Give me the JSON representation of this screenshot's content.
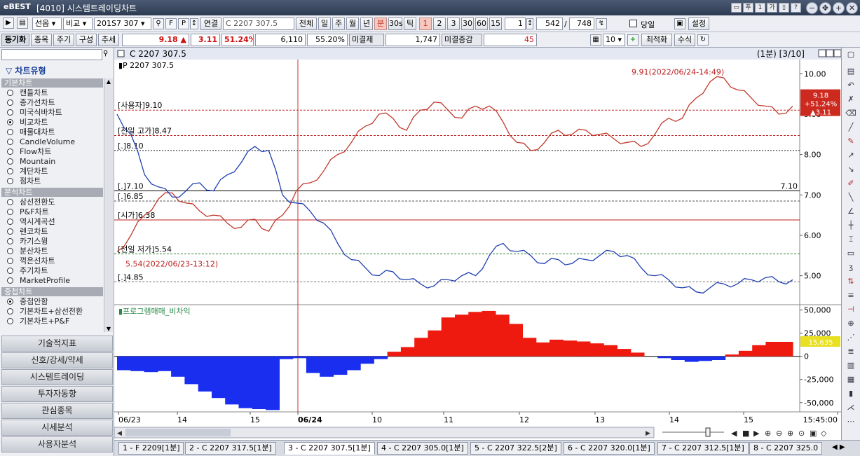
{
  "titlebar": {
    "logo": "eBEST",
    "code": "[4010]",
    "title": "시스템트레이딩차트"
  },
  "toolbar": {
    "product_type": "선옵",
    "compare": "비교",
    "contract": "201S7 307",
    "link": "연결",
    "contract_name": "C 2207 307.5",
    "all": "전체",
    "day": "일",
    "week": "주",
    "month": "월",
    "year": "년",
    "minute": "분",
    "sec30": "30s",
    "tick": "틱",
    "intervals": [
      "1",
      "2",
      "3",
      "30",
      "60",
      "15"
    ],
    "interval_value": "1",
    "view_count": "542",
    "total_count": "748",
    "same_day": "당일",
    "settings": "설정"
  },
  "toolbar2": {
    "sync": "동기화",
    "item": "종목",
    "period": "주기",
    "compose": "구성",
    "trend": "추세",
    "price": "9.18",
    "change": "3.11",
    "change_pct": "51.24%",
    "volume": "6,110",
    "ratio": "55.20%",
    "unsettled_label": "미결제",
    "unsettled_value": "1,747",
    "unsettled_chg_label": "미결증감",
    "unsettled_chg_value": "45",
    "chart_count": "10",
    "optimize": "최적화",
    "formula": "수식"
  },
  "sidebar": {
    "header": "차트유형",
    "basic_section": "기본차트",
    "basic_items": [
      {
        "label": "캔들차트",
        "selected": false
      },
      {
        "label": "종가선차트",
        "selected": false
      },
      {
        "label": "미국식바차트",
        "selected": false
      },
      {
        "label": "비교차트",
        "selected": true
      },
      {
        "label": "매물대차트",
        "selected": false
      },
      {
        "label": "CandleVolume",
        "selected": false
      },
      {
        "label": "Flow차트",
        "selected": false
      },
      {
        "label": "Mountain",
        "selected": false
      },
      {
        "label": "계단차트",
        "selected": false
      },
      {
        "label": "점차트",
        "selected": false
      }
    ],
    "analysis_section": "분석차트",
    "analysis_items": [
      {
        "label": "삼선전환도",
        "selected": false
      },
      {
        "label": "P&F차트",
        "selected": false
      },
      {
        "label": "역시계곡선",
        "selected": false
      },
      {
        "label": "렌코차트",
        "selected": false
      },
      {
        "label": "카기스윙",
        "selected": false
      },
      {
        "label": "분산차트",
        "selected": false
      },
      {
        "label": "꺽은선차트",
        "selected": false
      },
      {
        "label": "주기차트",
        "selected": false
      },
      {
        "label": "MarketProfile",
        "selected": false
      }
    ],
    "overlay_section": "중첩차트",
    "overlay_items": [
      {
        "label": "중첩안함",
        "selected": true
      },
      {
        "label": "기본차트+삼선전환",
        "selected": false
      },
      {
        "label": "기본차트+P&F",
        "selected": false
      }
    ],
    "categories": [
      "기술적지표",
      "신호/강세/약세",
      "시스템트레이딩",
      "투자자동향",
      "관심종목",
      "시세분석",
      "사용자분석"
    ]
  },
  "chart": {
    "header_name": "C 2207 307.5",
    "header_info": "(1분) [3/10]",
    "price_legend": "P 2207 307.5",
    "annotations": {
      "high": "9.91(2022/06/24-14:49)",
      "low": "5.54(2022/06/23-13:12)",
      "user": "[사용자]9.10",
      "prev_high": "[전일 고가]8.47",
      "l810": "[.]8.10",
      "l710": "[.]7.10",
      "l685": "[.]6.85",
      "open": "[시가]6.38",
      "prev_low": "[전일 저가]5.54",
      "l485": "[.]4.85",
      "right_710": "7.10"
    },
    "price_badge": [
      "9.18",
      "+51.24%",
      "▲3.11"
    ],
    "volume_legend": "프로그램매매_비차익",
    "volume_badge": "15,635",
    "x_labels": [
      "06/23",
      "14",
      "15",
      "06/24",
      "10",
      "11",
      "12",
      "13",
      "14",
      "15",
      "15:45:00"
    ]
  },
  "chart_data": [
    {
      "type": "line",
      "title": "C 2207 307.5",
      "ylim": [
        4.3,
        10.3
      ],
      "yticks": [
        "10.00",
        "9.00",
        "8.00",
        "7.00",
        "6.00",
        "5.00"
      ],
      "series": [
        {
          "name": "C 2207 307.5",
          "color": "#c0392b",
          "values": [
            5.6,
            6.0,
            6.5,
            6.9,
            7.05,
            6.8,
            6.6,
            6.5,
            6.3,
            6.2,
            6.4,
            6.1,
            6.5,
            7.1,
            7.3,
            7.6,
            8.0,
            8.3,
            8.7,
            9.0,
            8.9,
            8.6,
            9.1,
            9.3,
            9.1,
            8.9,
            9.2,
            9.2,
            8.8,
            8.3,
            8.1,
            8.3,
            8.6,
            8.5,
            8.6,
            8.5,
            8.4,
            8.3,
            8.2,
            8.5,
            8.9,
            8.9,
            9.4,
            9.8,
            9.9,
            9.6,
            9.4,
            9.2,
            9.0,
            9.2
          ]
        },
        {
          "name": "P 2207 307.5",
          "color": "#1f3fb0",
          "values": [
            9.0,
            8.5,
            7.5,
            7.2,
            6.95,
            7.1,
            7.3,
            7.1,
            7.5,
            7.8,
            8.2,
            8.1,
            7.0,
            6.8,
            6.6,
            6.3,
            5.8,
            5.4,
            5.2,
            5.0,
            5.1,
            4.9,
            4.8,
            4.75,
            4.9,
            5.0,
            5.0,
            5.5,
            5.8,
            5.6,
            5.5,
            5.3,
            5.4,
            5.3,
            5.4,
            5.5,
            5.6,
            5.5,
            5.2,
            5.0,
            4.9,
            4.7,
            4.6,
            4.7,
            4.8,
            4.8,
            4.9,
            4.95,
            4.85,
            4.9
          ]
        }
      ]
    },
    {
      "type": "area",
      "title": "프로그램매매_비차익",
      "ylim": [
        -60000,
        55000
      ],
      "yticks": [
        "50,000",
        "25,000",
        "0",
        "-25,000",
        "-50,000"
      ],
      "series": [
        {
          "name": "프로그램매매_비차익",
          "values": [
            -15000,
            -16000,
            -17000,
            -16000,
            -22000,
            -30000,
            -38000,
            -45000,
            -52000,
            -56000,
            -57000,
            -58000,
            -3000,
            -2000,
            -18000,
            -22000,
            -20000,
            -15000,
            -8000,
            -3000,
            5000,
            10000,
            20000,
            28000,
            42000,
            45000,
            48000,
            49000,
            45000,
            35000,
            20000,
            15000,
            18000,
            17000,
            16000,
            14000,
            12000,
            8000,
            4000,
            0,
            -2000,
            -4000,
            -6000,
            -5000,
            -4000,
            2000,
            6000,
            12000,
            15635,
            15635
          ]
        }
      ]
    }
  ]
}
